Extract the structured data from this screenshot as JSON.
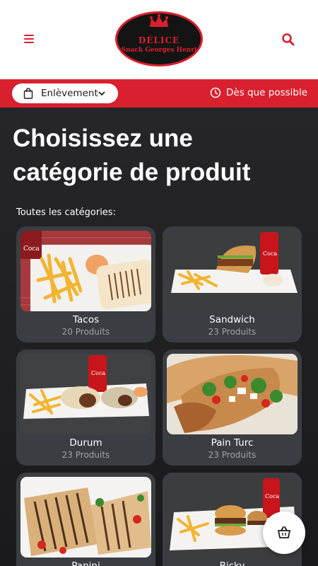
{
  "header": {
    "menu_icon": "hamburger-icon",
    "search_icon": "search-icon",
    "logo": {
      "title": "DÉLICE",
      "subtitle": "Snack Georges Henri"
    }
  },
  "order_bar": {
    "mode_label": "Enlèvement",
    "mode_icon": "shopping-bag-icon",
    "time_label": "Dès que possible",
    "time_icon": "clock-icon",
    "color": "#d9202e"
  },
  "page": {
    "title": "Choisissez une catégorie de produit",
    "section_label": "Toutes les catégories:"
  },
  "categories": [
    {
      "name": "Tacos",
      "count": "20 Produits"
    },
    {
      "name": "Sandwich",
      "count": "23 Produits"
    },
    {
      "name": "Durum",
      "count": "23 Produits"
    },
    {
      "name": "Pain Turc",
      "count": "23 Produits"
    },
    {
      "name": "Panini",
      "count": ""
    },
    {
      "name": "Bicky",
      "count": ""
    }
  ],
  "cart": {
    "icon": "basket-icon"
  },
  "colors": {
    "accent": "#d9202e",
    "background": "#1c1c1e",
    "card": "#3a3e43"
  }
}
